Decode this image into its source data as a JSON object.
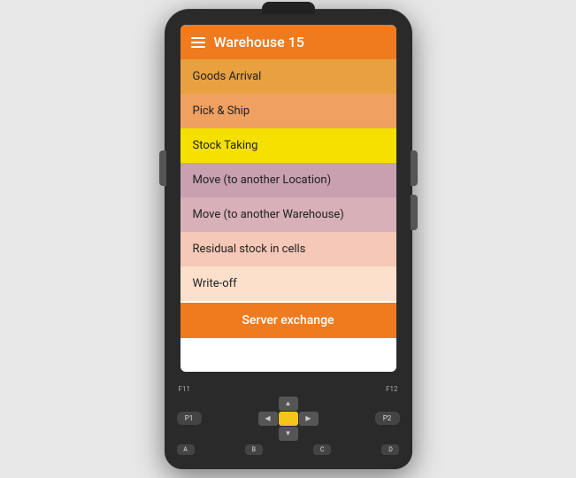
{
  "header": {
    "title": "Warehouse 15",
    "menu_icon": "hamburger-icon"
  },
  "menu_items": [
    {
      "label": "Goods Arrival",
      "color_class": "menu-item-0"
    },
    {
      "label": "Pick & Ship",
      "color_class": "menu-item-1"
    },
    {
      "label": "Stock Taking",
      "color_class": "menu-item-2"
    },
    {
      "label": "Move (to another Location)",
      "color_class": "menu-item-3"
    },
    {
      "label": "Move (to another Warehouse)",
      "color_class": "menu-item-4"
    },
    {
      "label": "Residual stock in cells",
      "color_class": "menu-item-5"
    },
    {
      "label": "Write-off",
      "color_class": "menu-item-6"
    }
  ],
  "server_exchange_label": "Server exchange",
  "keypad": {
    "f11": "F11",
    "f12": "F12",
    "p1": "P1",
    "p2": "P2",
    "row_keys": [
      "A",
      "B",
      "C",
      "D"
    ]
  }
}
